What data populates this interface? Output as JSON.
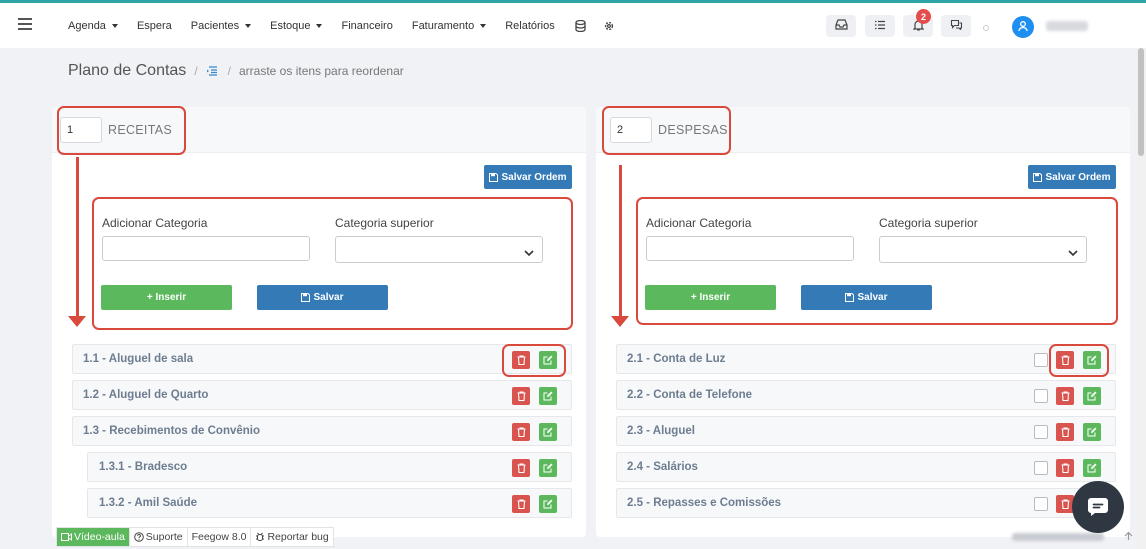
{
  "nav": {
    "items": [
      {
        "label": "Agenda",
        "dropdown": true
      },
      {
        "label": "Espera",
        "dropdown": false
      },
      {
        "label": "Pacientes",
        "dropdown": true
      },
      {
        "label": "Estoque",
        "dropdown": true
      },
      {
        "label": "Financeiro",
        "dropdown": false
      },
      {
        "label": "Faturamento",
        "dropdown": true
      },
      {
        "label": "Relatórios",
        "dropdown": false
      }
    ],
    "icons": [
      "database-icon",
      "gear-icon"
    ],
    "right_icons": [
      "inbox-icon",
      "task-list-icon",
      "bell-icon",
      "chat-icon"
    ],
    "notification_count": "2",
    "accent": "#2ea4a6"
  },
  "breadcrumb": {
    "title": "Plano de Contas",
    "separator": "/",
    "hint": "arraste os itens para reordenar"
  },
  "buttons": {
    "save_order": "Salvar Ordem",
    "insert": "+ Inserir",
    "save": "Salvar"
  },
  "form": {
    "add_category_label": "Adicionar Categoria",
    "parent_category_label": "Categoria superior",
    "add_category_value": "",
    "parent_category_value": ""
  },
  "receitas": {
    "number": "1",
    "title": "RECEITAS",
    "items": [
      {
        "label": "1.1 - Aluguel de sala",
        "level": 0
      },
      {
        "label": "1.2 - Aluguel de Quarto",
        "level": 0
      },
      {
        "label": "1.3 - Recebimentos de Convênio",
        "level": 0
      },
      {
        "label": "1.3.1 - Bradesco",
        "level": 1
      },
      {
        "label": "1.3.2 - Amil Saúde",
        "level": 1
      }
    ]
  },
  "despesas": {
    "number": "2",
    "title": "DESPESAS",
    "items": [
      {
        "label": "2.1 - Conta de Luz",
        "level": 0
      },
      {
        "label": "2.2 - Conta de Telefone",
        "level": 0
      },
      {
        "label": "2.3 - Aluguel",
        "level": 0
      },
      {
        "label": "2.4 - Salários",
        "level": 0
      },
      {
        "label": "2.5 - Repasses e Comissões",
        "level": 0
      }
    ]
  },
  "footer": {
    "video": "Vídeo-aula",
    "support": "Suporte",
    "version": "Feegow 8.0",
    "report_bug": "Reportar bug"
  },
  "colors": {
    "annotation_red": "#d94a3d",
    "primary_blue": "#337ab7",
    "success_green": "#5cb85c",
    "danger_red": "#d9534f",
    "avatar_blue": "#1e8ef0"
  }
}
